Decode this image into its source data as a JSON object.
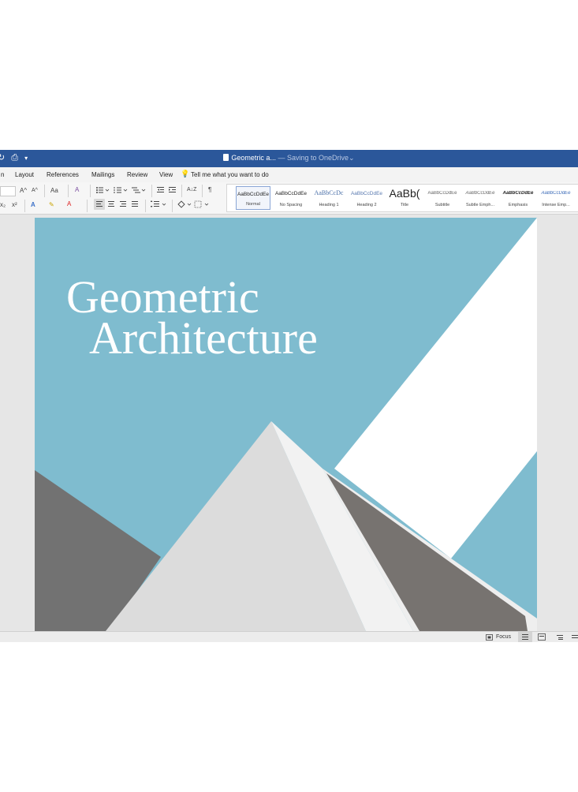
{
  "window": {
    "title": "Geometric a...",
    "title_status": "— Saving to OneDrive",
    "chevron": "⌄"
  },
  "quick_access": {
    "redo_icon": "↻",
    "print_icon": "⎙",
    "customize_icon": "▾"
  },
  "menu": {
    "items": [
      "n",
      "Layout",
      "References",
      "Mailings",
      "Review",
      "View"
    ],
    "tell_me_icon": "💡",
    "tell_me": "Tell me what you want to do"
  },
  "ribbon": {
    "grow_font": "A^",
    "shrink_font": "A^",
    "change_case": "Aa",
    "clear_format": "A",
    "subscript": "x₂",
    "superscript": "x²",
    "text_effects": "A",
    "highlight": "✎",
    "font_color": "A",
    "show_marks": "¶",
    "sort": "A↓Z"
  },
  "styles": [
    {
      "preview": "AaBbCcDdEe",
      "label": "Normal"
    },
    {
      "preview": "AaBbCcDdEe",
      "label": "No Spacing"
    },
    {
      "preview": "AaBbCcDc",
      "label": "Heading 1"
    },
    {
      "preview": "AaBbCcDdEe",
      "label": "Heading 2"
    },
    {
      "preview": "AaBb(",
      "label": "Title"
    },
    {
      "preview": "AaBbCcDdEe",
      "label": "Subtitle"
    },
    {
      "preview": "AaBbCcDdEe",
      "label": "Subtle Emph..."
    },
    {
      "preview": "AaBbCcDdEe",
      "label": "Emphasis"
    },
    {
      "preview": "AaBbCcDdEe",
      "label": "Intense Emp..."
    }
  ],
  "document": {
    "title_line1": "Geometric",
    "title_line2": "Architecture"
  },
  "status": {
    "focus": "Focus"
  },
  "colors": {
    "title_bar": "#2b579a",
    "page_blue": "#7fbccf",
    "gray_slope": "#727272",
    "light_pyramid": "#dddddd",
    "dark_face": "#777370"
  }
}
